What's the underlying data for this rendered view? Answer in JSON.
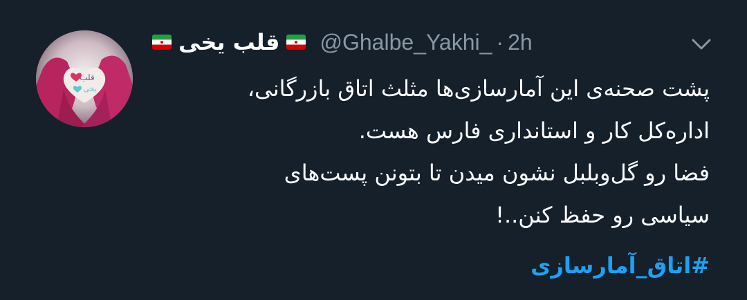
{
  "author": {
    "display_name": "قلب یخی",
    "handle": "@Ghalbe_Yakhi_",
    "separator": "·",
    "timestamp": "2h",
    "flag_icon": "iran-flag-icon"
  },
  "tweet": {
    "lines": [
      "پشت صحنه‌ی این آمارسازی‌ها مثلث اتاق بازرگانی،",
      "اداره‌کل کار و استانداری فارس هست.",
      "فضا رو گل‌وبلبل نشون میدن تا بتونن پست‌های",
      "سیاسی رو حفظ کنن..!"
    ],
    "hashtag": "#اتاق_آمارسازی"
  },
  "colors": {
    "background": "#15202b",
    "text": "#ffffff",
    "secondary": "#8899a6",
    "link": "#1da1f2"
  },
  "icons": {
    "menu": "chevron-down-icon"
  }
}
